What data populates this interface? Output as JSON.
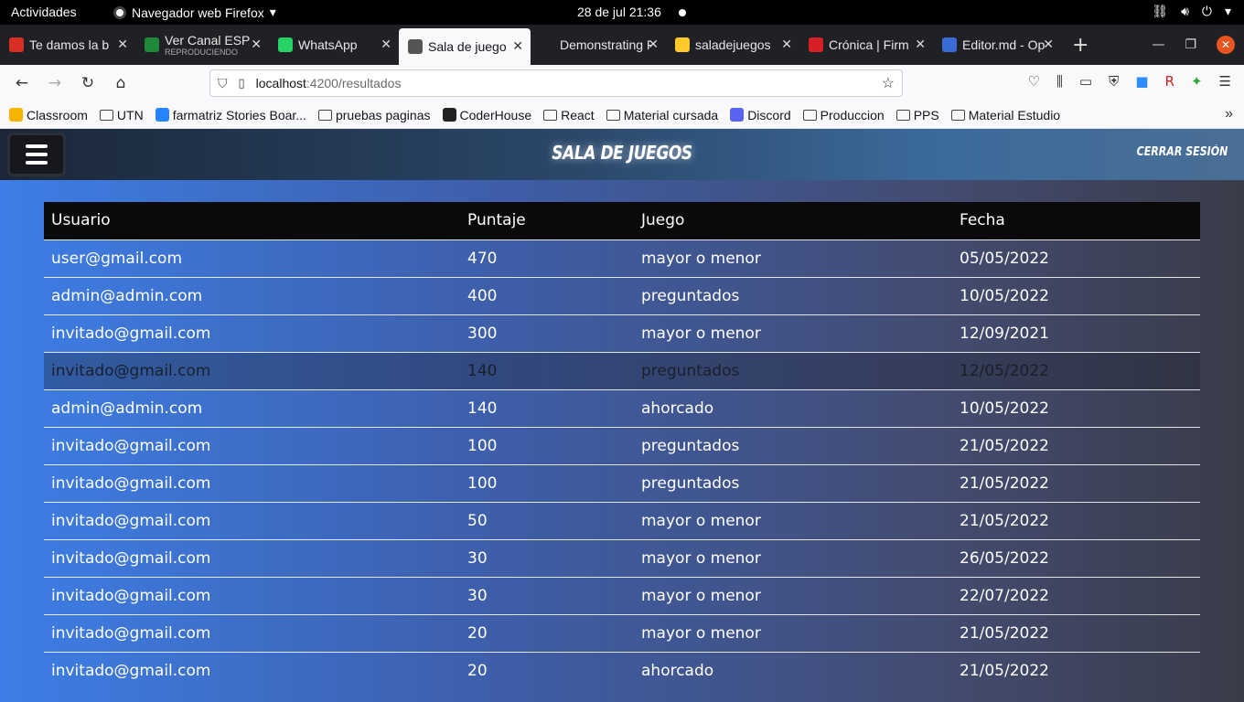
{
  "system": {
    "activities": "Actividades",
    "app_menu": "Navegador web Firefox",
    "clock": "28 de jul  21:36"
  },
  "tabs": [
    {
      "title": "Te damos la b",
      "favicon": "gmail-icon",
      "color": "#d93025"
    },
    {
      "title": "Ver Canal ESP",
      "subtitle": "REPRODUCIENDO",
      "favicon": "soccer-icon",
      "color": "#1f8a3a"
    },
    {
      "title": "WhatsApp",
      "favicon": "whatsapp-icon",
      "color": "#25d366"
    },
    {
      "title": "Sala de juego",
      "favicon": "game-icon",
      "color": "#555",
      "active": true
    },
    {
      "title": "Demonstrating R",
      "favicon": "",
      "color": "transparent"
    },
    {
      "title": "saladejuegos",
      "favicon": "firebase-icon",
      "color": "#ffca28"
    },
    {
      "title": "Crónica | Firm",
      "favicon": "cronica-icon",
      "color": "#d61f26"
    },
    {
      "title": "Editor.md - Op",
      "favicon": "markdown-icon",
      "color": "#3b6bd6"
    }
  ],
  "url": {
    "host": "localhost",
    "path": ":4200/resultados"
  },
  "bookmarks": [
    {
      "label": "Classroom",
      "icon": "classroom-icon",
      "color": "#f4b400"
    },
    {
      "label": "UTN",
      "icon": "folder-icon"
    },
    {
      "label": "farmatriz Stories Boar...",
      "icon": "jira-icon",
      "color": "#2684ff"
    },
    {
      "label": "pruebas paginas",
      "icon": "folder-icon"
    },
    {
      "label": "CoderHouse",
      "icon": "coderhouse-icon",
      "color": "#222"
    },
    {
      "label": "React",
      "icon": "folder-icon"
    },
    {
      "label": "Material cursada",
      "icon": "folder-icon"
    },
    {
      "label": "Discord",
      "icon": "discord-icon",
      "color": "#5865f2"
    },
    {
      "label": "Produccion",
      "icon": "folder-icon"
    },
    {
      "label": "PPS",
      "icon": "folder-icon"
    },
    {
      "label": "Material Estudio",
      "icon": "folder-icon"
    }
  ],
  "app": {
    "title": "Sala de Juegos",
    "logout": "Cerrar Sesión"
  },
  "table": {
    "headers": [
      "Usuario",
      "Puntaje",
      "Juego",
      "Fecha"
    ],
    "rows": [
      [
        "user@gmail.com",
        "470",
        "mayor o menor",
        "05/05/2022"
      ],
      [
        "admin@admin.com",
        "400",
        "preguntados",
        "10/05/2022"
      ],
      [
        "invitado@gmail.com",
        "300",
        "mayor o menor",
        "12/09/2021"
      ],
      [
        "invitado@gmail.com",
        "140",
        "preguntados",
        "12/05/2022"
      ],
      [
        "admin@admin.com",
        "140",
        "ahorcado",
        "10/05/2022"
      ],
      [
        "invitado@gmail.com",
        "100",
        "preguntados",
        "21/05/2022"
      ],
      [
        "invitado@gmail.com",
        "100",
        "preguntados",
        "21/05/2022"
      ],
      [
        "invitado@gmail.com",
        "50",
        "mayor o menor",
        "21/05/2022"
      ],
      [
        "invitado@gmail.com",
        "30",
        "mayor o menor",
        "26/05/2022"
      ],
      [
        "invitado@gmail.com",
        "30",
        "mayor o menor",
        "22/07/2022"
      ],
      [
        "invitado@gmail.com",
        "20",
        "mayor o menor",
        "21/05/2022"
      ],
      [
        "invitado@gmail.com",
        "20",
        "ahorcado",
        "21/05/2022"
      ]
    ]
  }
}
